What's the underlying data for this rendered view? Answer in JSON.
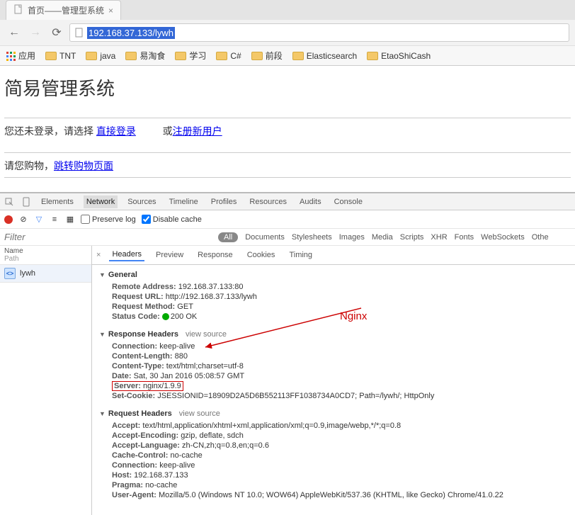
{
  "browser": {
    "tab_title": "首页——管理型系统",
    "url_selected": "192.168.37.133/lywh",
    "bookmarks": {
      "apps": "应用",
      "items": [
        "TNT",
        "java",
        "易淘食",
        "学习",
        "C#",
        "前段",
        "Elasticsearch",
        "EtaoShiCash"
      ]
    }
  },
  "page": {
    "title": "简易管理系统",
    "login_prompt": "您还未登录，请选择",
    "login_link": "直接登录",
    "or_text": "或",
    "register_link": "注册新用户",
    "shop_prompt": "请您购物，",
    "shop_link": "跳转购物页面"
  },
  "devtools": {
    "tabs": [
      "Elements",
      "Network",
      "Sources",
      "Timeline",
      "Profiles",
      "Resources",
      "Audits",
      "Console"
    ],
    "active_tab": "Network",
    "preserve_log": "Preserve log",
    "disable_cache": "Disable cache",
    "filter_placeholder": "Filter",
    "filter_types": [
      "Documents",
      "Stylesheets",
      "Images",
      "Media",
      "Scripts",
      "XHR",
      "Fonts",
      "WebSockets",
      "Othe"
    ],
    "filter_all": "All",
    "sidebar_head_name": "Name",
    "sidebar_head_path": "Path",
    "request_name": "lywh",
    "detail_tabs": [
      "Headers",
      "Preview",
      "Response",
      "Cookies",
      "Timing"
    ],
    "active_detail_tab": "Headers",
    "general": {
      "title": "General",
      "remote_address": {
        "k": "Remote Address:",
        "v": "192.168.37.133:80"
      },
      "request_url": {
        "k": "Request URL:",
        "v": "http://192.168.37.133/lywh"
      },
      "request_method": {
        "k": "Request Method:",
        "v": "GET"
      },
      "status_code": {
        "k": "Status Code:",
        "v": "200 OK"
      }
    },
    "response_headers": {
      "title": "Response Headers",
      "view_source": "view source",
      "connection": {
        "k": "Connection:",
        "v": "keep-alive"
      },
      "content_length": {
        "k": "Content-Length:",
        "v": "880"
      },
      "content_type": {
        "k": "Content-Type:",
        "v": "text/html;charset=utf-8"
      },
      "date": {
        "k": "Date:",
        "v": "Sat, 30 Jan 2016 05:08:57 GMT"
      },
      "server": {
        "k": "Server:",
        "v": "nginx/1.9.9"
      },
      "set_cookie": {
        "k": "Set-Cookie:",
        "v": "JSESSIONID=18909D2A5D6B552113FF1038734A0CD7; Path=/lywh/; HttpOnly"
      }
    },
    "request_headers": {
      "title": "Request Headers",
      "view_source": "view source",
      "accept": {
        "k": "Accept:",
        "v": "text/html,application/xhtml+xml,application/xml;q=0.9,image/webp,*/*;q=0.8"
      },
      "accept_encoding": {
        "k": "Accept-Encoding:",
        "v": "gzip, deflate, sdch"
      },
      "accept_language": {
        "k": "Accept-Language:",
        "v": "zh-CN,zh;q=0.8,en;q=0.6"
      },
      "cache_control": {
        "k": "Cache-Control:",
        "v": "no-cache"
      },
      "connection": {
        "k": "Connection:",
        "v": "keep-alive"
      },
      "host": {
        "k": "Host:",
        "v": "192.168.37.133"
      },
      "pragma": {
        "k": "Pragma:",
        "v": "no-cache"
      },
      "user_agent": {
        "k": "User-Agent:",
        "v": "Mozilla/5.0 (Windows NT 10.0; WOW64) AppleWebKit/537.36 (KHTML, like Gecko) Chrome/41.0.22"
      }
    }
  },
  "annotation": {
    "label": "Nginx"
  }
}
